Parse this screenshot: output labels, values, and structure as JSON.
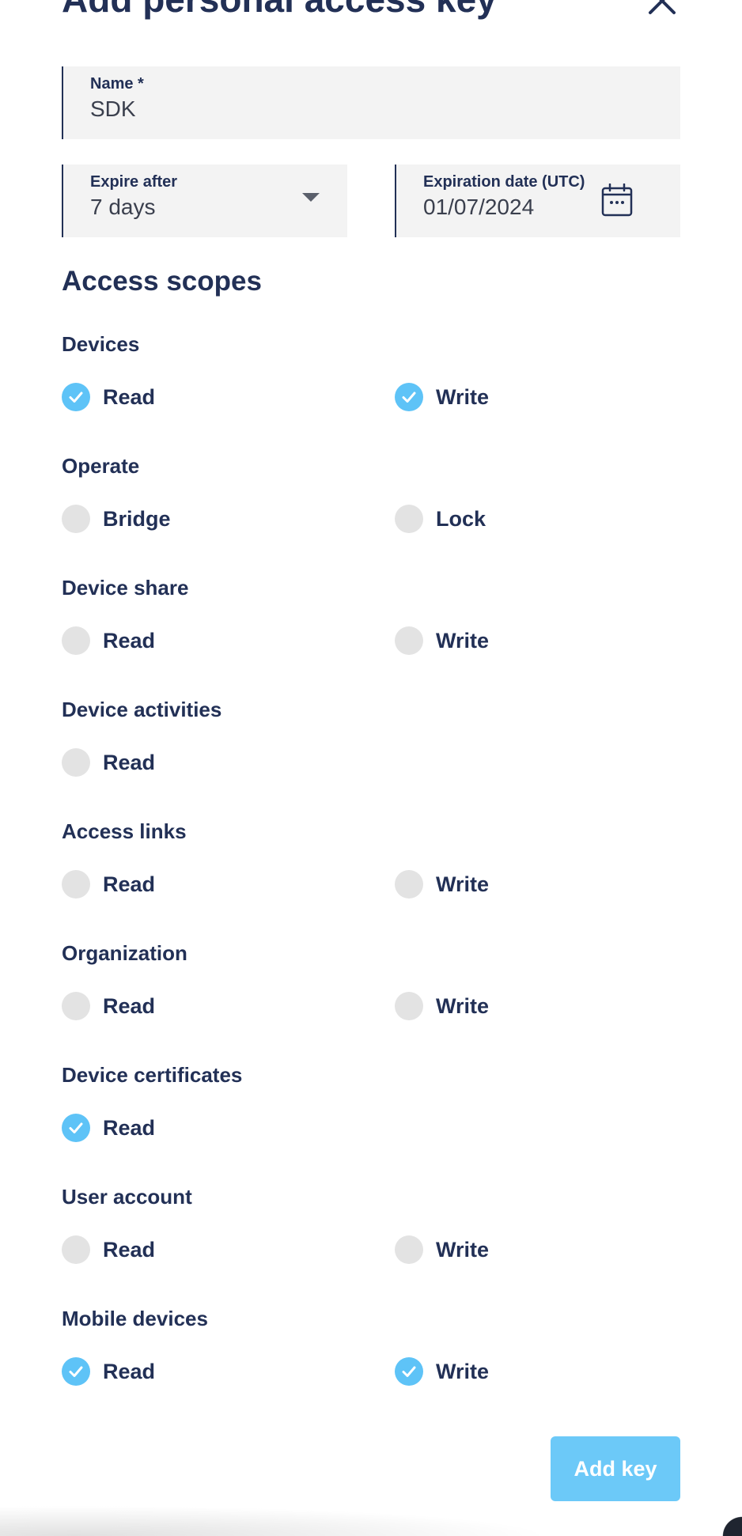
{
  "dialog": {
    "title": "Add personal access key"
  },
  "form": {
    "name": {
      "label": "Name *",
      "value": "SDK"
    },
    "expire_after": {
      "label": "Expire after",
      "value": "7 days"
    },
    "expiration_date": {
      "label": "Expiration date (UTC)",
      "value": "01/07/2024"
    }
  },
  "scopes": {
    "title": "Access scopes",
    "groups": [
      {
        "title": "Devices",
        "options": [
          {
            "label": "Read",
            "checked": true
          },
          {
            "label": "Write",
            "checked": true
          }
        ]
      },
      {
        "title": "Operate",
        "options": [
          {
            "label": "Bridge",
            "checked": false
          },
          {
            "label": "Lock",
            "checked": false
          }
        ]
      },
      {
        "title": "Device share",
        "options": [
          {
            "label": "Read",
            "checked": false
          },
          {
            "label": "Write",
            "checked": false
          }
        ]
      },
      {
        "title": "Device activities",
        "options": [
          {
            "label": "Read",
            "checked": false
          }
        ]
      },
      {
        "title": "Access links",
        "options": [
          {
            "label": "Read",
            "checked": false
          },
          {
            "label": "Write",
            "checked": false
          }
        ]
      },
      {
        "title": "Organization",
        "options": [
          {
            "label": "Read",
            "checked": false
          },
          {
            "label": "Write",
            "checked": false
          }
        ]
      },
      {
        "title": "Device certificates",
        "options": [
          {
            "label": "Read",
            "checked": true
          }
        ]
      },
      {
        "title": "User account",
        "options": [
          {
            "label": "Read",
            "checked": false
          },
          {
            "label": "Write",
            "checked": false
          }
        ]
      },
      {
        "title": "Mobile devices",
        "options": [
          {
            "label": "Read",
            "checked": true
          },
          {
            "label": "Write",
            "checked": true
          }
        ]
      }
    ]
  },
  "actions": {
    "add_key_label": "Add key"
  },
  "colors": {
    "text": "#223056",
    "accent": "#5ec3f7",
    "button": "#6cc9f8",
    "field_bg": "#f3f3f3",
    "unchecked": "#e3e3e3"
  }
}
